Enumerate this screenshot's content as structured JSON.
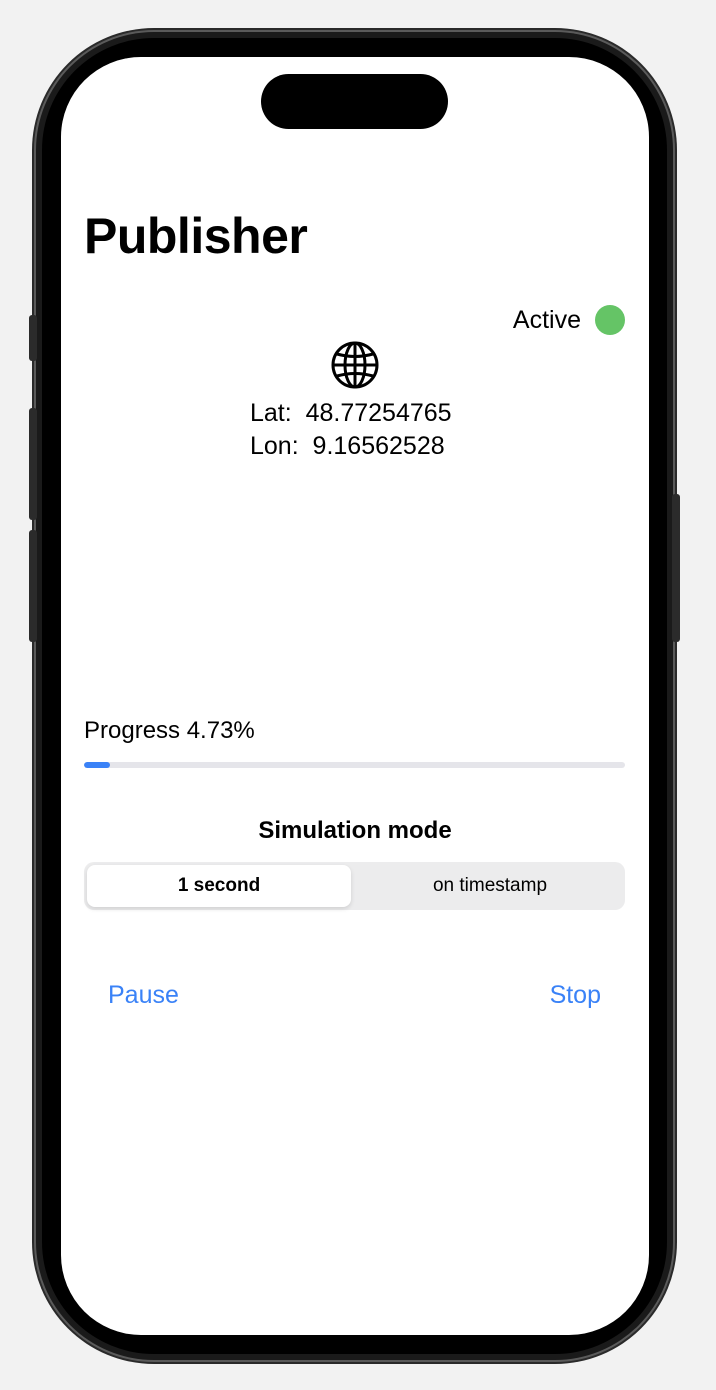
{
  "header": {
    "title": "Publisher"
  },
  "status": {
    "label": "Active",
    "color": "#65c466"
  },
  "location": {
    "icon": "globe-icon",
    "lat_line": "Lat:  48.77254765",
    "lon_line": "Lon:  9.16562528"
  },
  "progress": {
    "label": "Progress 4.73%",
    "fraction": 0.0473,
    "color": "#3a82f7"
  },
  "simulation": {
    "title": "Simulation mode",
    "options": [
      "1 second",
      "on timestamp"
    ],
    "selected": "1 second"
  },
  "actions": {
    "pause_label": "Pause",
    "stop_label": "Stop",
    "color": "#3a82f7"
  }
}
